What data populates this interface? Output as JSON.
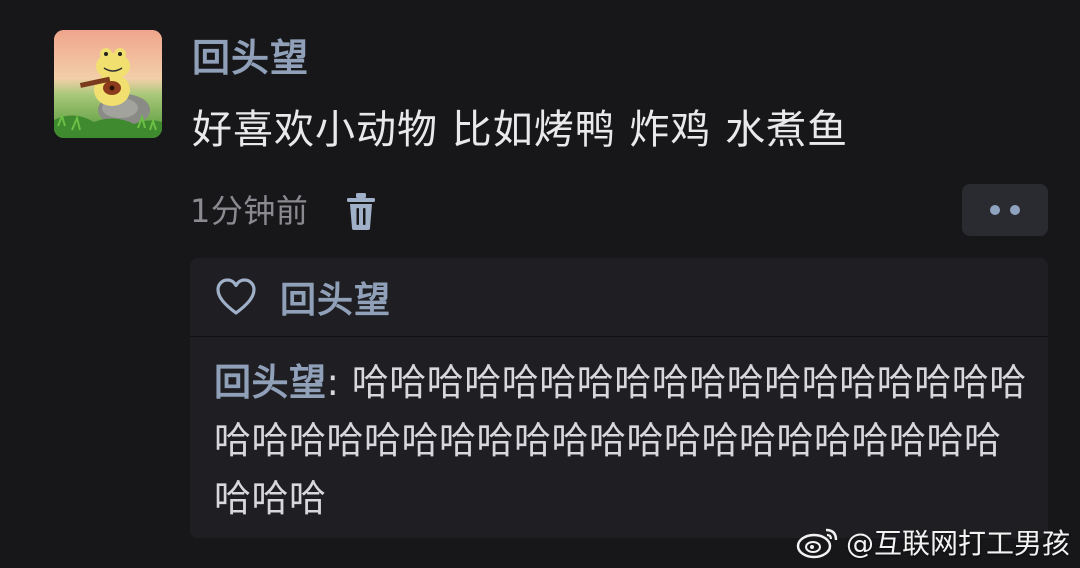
{
  "post": {
    "username": "回头望",
    "comment": "好喜欢小动物 比如烤鸭 炸鸡 水煮鱼",
    "time": "1分钟前",
    "avatar_icon": "frog-guitar-avatar",
    "delete_icon": "trash-icon",
    "more_icon": "more-dots-icon"
  },
  "reply_card": {
    "liker": "回头望",
    "heart_icon": "heart-outline-icon",
    "reply_author": "回头望",
    "reply_separator": ": ",
    "reply_text": "哈哈哈哈哈哈哈哈哈哈哈哈哈哈哈哈哈哈哈哈哈哈哈哈哈哈哈哈哈哈哈哈哈哈哈哈哈哈哈哈哈哈"
  },
  "watermark": {
    "logo_icon": "weibo-logo-icon",
    "text": "@互联网打工男孩"
  },
  "colors": {
    "background": "#17171a",
    "card": "#1f1f23",
    "name_blue": "#8fa0b8",
    "text_primary": "#e9e9ec",
    "text_secondary": "#8a8a90"
  }
}
